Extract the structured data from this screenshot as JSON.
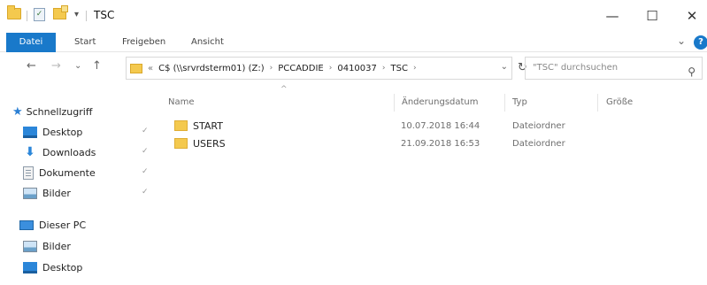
{
  "window": {
    "title": "TSC",
    "qa_dropdown": "▾",
    "minimize": "—",
    "maximize": "☐",
    "close": "✕"
  },
  "ribbon": {
    "tabs": [
      "Datei",
      "Start",
      "Freigeben",
      "Ansicht"
    ],
    "expand": "⌄",
    "help": "?"
  },
  "address": {
    "back": "←",
    "forward": "→",
    "recent": "⌄",
    "up": "↑",
    "overflow": "«",
    "crumbs": [
      "C$ (\\\\srvrdsterm01) (Z:)",
      "PCCADDIE",
      "0410037",
      "TSC"
    ],
    "crumb_sep": "›",
    "dropdown": "⌄",
    "refresh": "↻",
    "search_placeholder": "\"TSC\" durchsuchen",
    "search_icon": "⚲"
  },
  "navpane": {
    "quick_access": "Schnellzugriff",
    "items": [
      "Desktop",
      "Downloads",
      "Dokumente",
      "Bilder"
    ],
    "pin": "✓",
    "this_pc": "Dieser PC",
    "pc_items": [
      "Bilder",
      "Desktop"
    ]
  },
  "list": {
    "sort_arrow": "^",
    "columns": {
      "name": "Name",
      "date": "Änderungsdatum",
      "type": "Typ",
      "size": "Größe"
    },
    "rows": [
      {
        "name": "START",
        "date": "10.07.2018 16:44",
        "type": "Dateiordner"
      },
      {
        "name": "USERS",
        "date": "21.09.2018 16:53",
        "type": "Dateiordner"
      }
    ]
  },
  "colors": {
    "accent": "#1979ca",
    "folder": "#f4c94e"
  }
}
